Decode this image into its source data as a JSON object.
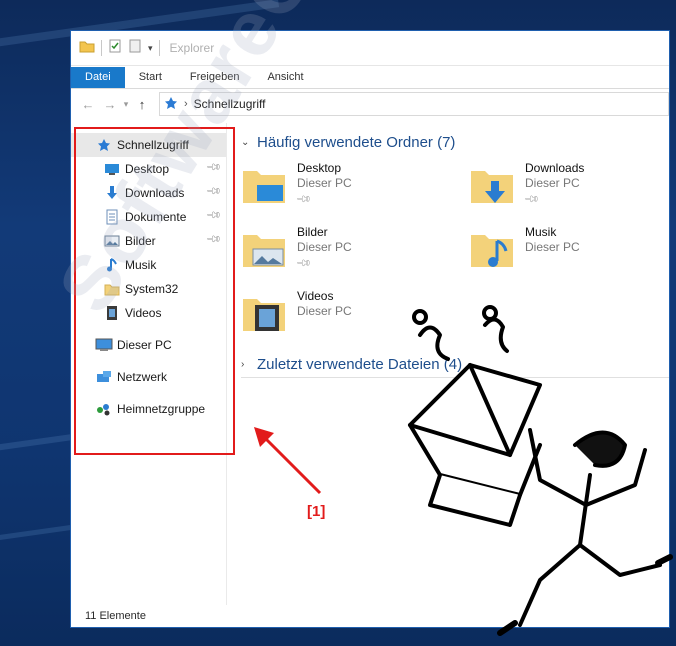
{
  "window": {
    "title": "Explorer"
  },
  "ribbon": {
    "tabs": [
      "Datei",
      "Start",
      "Freigeben",
      "Ansicht"
    ]
  },
  "address": {
    "crumb": "Schnellzugriff"
  },
  "nav": {
    "quick_access": "Schnellzugriff",
    "pinned": [
      {
        "label": "Desktop",
        "icon": "desktop-icon",
        "pinned": true
      },
      {
        "label": "Downloads",
        "icon": "downloads-icon",
        "pinned": true
      },
      {
        "label": "Dokumente",
        "icon": "documents-icon",
        "pinned": true
      },
      {
        "label": "Bilder",
        "icon": "pictures-icon",
        "pinned": true
      },
      {
        "label": "Musik",
        "icon": "music-icon",
        "pinned": false
      },
      {
        "label": "System32",
        "icon": "folder-icon",
        "pinned": false
      },
      {
        "label": "Videos",
        "icon": "videos-icon",
        "pinned": false
      }
    ],
    "this_pc": "Dieser PC",
    "network": "Netzwerk",
    "homegroup": "Heimnetzgruppe"
  },
  "content": {
    "frequent_header": "Häufig verwendete Ordner (7)",
    "recent_header": "Zuletzt verwendete Dateien (4)",
    "folders": [
      {
        "name": "Desktop",
        "location": "Dieser PC",
        "pinned": true,
        "icon": "desktop-folder-icon"
      },
      {
        "name": "Downloads",
        "location": "Dieser PC",
        "pinned": true,
        "icon": "downloads-folder-icon"
      },
      {
        "name": "Bilder",
        "location": "Dieser PC",
        "pinned": true,
        "icon": "pictures-folder-icon"
      },
      {
        "name": "Musik",
        "location": "Dieser PC",
        "pinned": false,
        "icon": "music-folder-icon"
      },
      {
        "name": "Videos",
        "location": "Dieser PC",
        "pinned": false,
        "icon": "videos-folder-icon"
      }
    ]
  },
  "status": {
    "count": "11 Elemente"
  },
  "annotation": {
    "label": "[1]"
  },
  "watermark": "SoftwareOK.de",
  "colors": {
    "accent": "#1979ca",
    "highlight": "#e21b1b",
    "link": "#1e4e8c"
  }
}
